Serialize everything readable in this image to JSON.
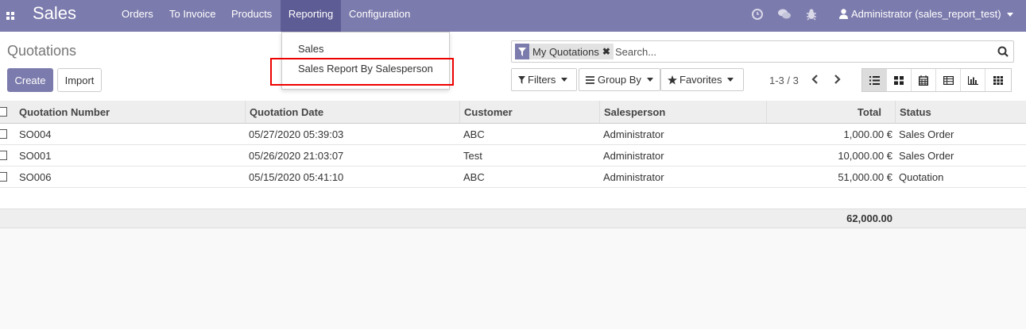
{
  "app": {
    "brand": "Sales"
  },
  "menu": {
    "items": [
      {
        "label": "Orders"
      },
      {
        "label": "To Invoice"
      },
      {
        "label": "Products"
      },
      {
        "label": "Reporting"
      },
      {
        "label": "Configuration"
      }
    ]
  },
  "user": {
    "name": "Administrator (sales_report_test)"
  },
  "page": {
    "title": "Quotations"
  },
  "buttons": {
    "create": "Create",
    "import": "Import"
  },
  "search": {
    "facet_label": "My Quotations",
    "placeholder": "Search..."
  },
  "filters": {
    "filters": "Filters",
    "group_by": "Group By",
    "favorites": "Favorites"
  },
  "pager": {
    "range": "1-3 / 3"
  },
  "reporting_dropdown": {
    "items": [
      {
        "label": "Sales"
      },
      {
        "label": "Sales Report By Salesperson"
      }
    ]
  },
  "table": {
    "headers": [
      "Quotation Number",
      "Quotation Date",
      "Customer",
      "Salesperson",
      "Total",
      "Status"
    ],
    "rows": [
      [
        "SO004",
        "05/27/2020 05:39:03",
        "ABC",
        "Administrator",
        "1,000.00 €",
        "Sales Order"
      ],
      [
        "SO001",
        "05/26/2020 21:03:07",
        "Test",
        "Administrator",
        "10,000.00 €",
        "Sales Order"
      ],
      [
        "SO006",
        "05/15/2020 05:41:10",
        "ABC",
        "Administrator",
        "51,000.00 €",
        "Quotation"
      ]
    ],
    "footer_total": "62,000.00"
  },
  "colors": {
    "brand": "#7c7bad",
    "menu_active": "#5e5c95",
    "highlight": "#ee0000"
  }
}
